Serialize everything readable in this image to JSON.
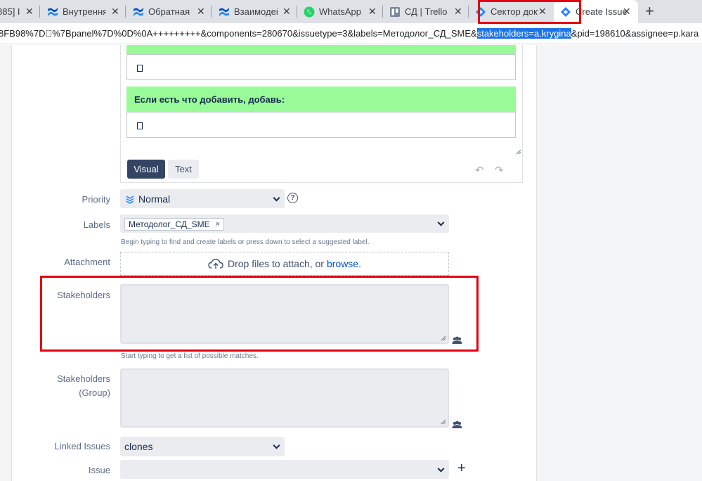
{
  "browser": {
    "tabs": [
      {
        "label": "885] I",
        "active": false
      },
      {
        "label": "Внутренняя",
        "active": false
      },
      {
        "label": "Обратная с",
        "active": false
      },
      {
        "label": "Взаимодейс",
        "active": false
      },
      {
        "label": "WhatsApp",
        "active": false
      },
      {
        "label": "СД | Trello",
        "active": false
      },
      {
        "label": "Сектор доку",
        "active": false
      },
      {
        "label": "Create Issue",
        "active": true
      }
    ],
    "new_tab_symbol": "+",
    "close_symbol": "✕",
    "url_before": "8FB98%7D\u0000%7Bpanel%7D%0D%0A+++++++++&components=280670&issuetype=3&labels=Методолог_СД_SME&",
    "url_highlight": "stakeholders=a.krygina",
    "url_after": "&pid=198610&assignee=p.kara"
  },
  "editor": {
    "section_label": "Если есть что добавить, добавь:",
    "visual_button": "Visual",
    "text_button": "Text",
    "undo_symbol": "↶",
    "redo_symbol": "↷"
  },
  "form": {
    "priority": {
      "label": "Priority",
      "value": "Normal",
      "help": "?"
    },
    "labels": {
      "label": "Labels",
      "chip": "Методолог_СД_SME",
      "chip_remove": "×",
      "hint": "Begin typing to find and create labels or press down to select a suggested label."
    },
    "attachment": {
      "label": "Attachment",
      "text": "Drop files to attach, or",
      "link": "browse."
    },
    "stakeholders": {
      "label": "Stakeholders",
      "hint": "Start typing to get a list of possible matches."
    },
    "stakeholders_group": {
      "label_line1": "Stakeholders",
      "label_line2": "(Group)"
    },
    "linked_issues": {
      "label": "Linked Issues",
      "value": "clones"
    },
    "issue": {
      "label": "Issue",
      "add": "+"
    }
  },
  "colors": {
    "highlight_red": "#e3000f",
    "green_header": "#98fb98",
    "url_selection": "#1a73e8",
    "jira_dark": "#344563",
    "link_blue": "#0052cc"
  },
  "icons": [
    "jira-icon",
    "confluence-icon",
    "whatsapp-icon",
    "trello-icon",
    "cloud-upload-icon",
    "people-icon",
    "help-icon",
    "priority-normal-icon"
  ]
}
